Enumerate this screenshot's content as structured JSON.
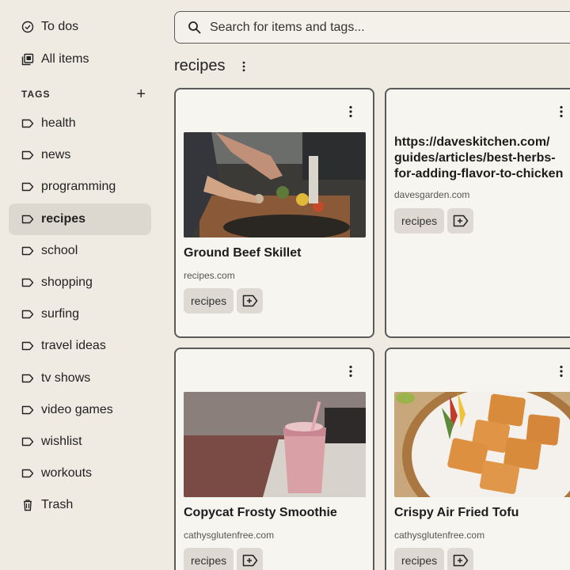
{
  "sidebar": {
    "top_items": [
      {
        "label": "To dos",
        "icon": "check-circle-icon"
      },
      {
        "label": "All items",
        "icon": "stack-icon"
      }
    ],
    "tags_header": "TAGS",
    "add_tag_symbol": "+",
    "tags": [
      {
        "label": "health"
      },
      {
        "label": "news"
      },
      {
        "label": "programming"
      },
      {
        "label": "recipes",
        "active": true
      },
      {
        "label": "school"
      },
      {
        "label": "shopping"
      },
      {
        "label": "surfing"
      },
      {
        "label": "travel ideas"
      },
      {
        "label": "tv shows"
      },
      {
        "label": "video games"
      },
      {
        "label": "wishlist"
      },
      {
        "label": "workouts"
      }
    ],
    "trash": {
      "label": "Trash",
      "icon": "trash-icon"
    }
  },
  "search": {
    "placeholder": "Search for items and tags..."
  },
  "page": {
    "title": "recipes"
  },
  "cards": [
    {
      "title": "Ground Beef Skillet",
      "domain": "recipes.com",
      "tag": "recipes",
      "image": "cooking-photo"
    },
    {
      "title": "https://daveskitchen.com/guides/articles/best-herbs-for-adding-flavor-to-chicken",
      "title_lines": [
        "https://daveskitchen.com/",
        "guides/articles/best-herbs-",
        "for-adding-flavor-to-chicken"
      ],
      "domain": "davesgarden.com",
      "tag": "recipes",
      "image": null
    },
    {
      "title": "Copycat Frosty Smoothie",
      "domain": "cathysglutenfree.com",
      "tag": "recipes",
      "image": "smoothie-photo"
    },
    {
      "title": "Crispy Air Fried Tofu",
      "domain": "cathysglutenfree.com",
      "tag": "recipes",
      "image": "tofu-photo"
    }
  ],
  "colors": {
    "background": "#efebe3",
    "active_item": "#ddd8cf",
    "chip": "#dedad3",
    "card_border": "#5a5a5a"
  }
}
